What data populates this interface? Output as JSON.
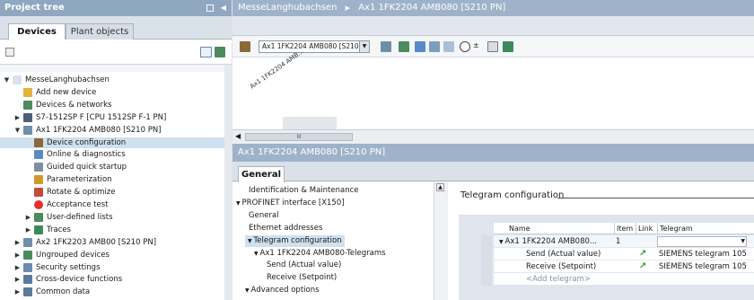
{
  "project_tree": {
    "title": "Project tree",
    "tabs": [
      "Devices",
      "Plant objects"
    ],
    "items": [
      {
        "label": "MesseLanghubachsen",
        "indent": 0,
        "arrow": "down",
        "icon": "project-icon",
        "color": "#d8e2ee"
      },
      {
        "label": "Add new device",
        "indent": 1,
        "arrow": "",
        "icon": "add-device-icon",
        "color": "#e3b23c"
      },
      {
        "label": "Devices & networks",
        "indent": 1,
        "arrow": "",
        "icon": "network-icon",
        "color": "#4c8a5f"
      },
      {
        "label": "S7-1512SP F [CPU 1512SP F-1 PN]",
        "indent": 1,
        "arrow": "right",
        "icon": "cpu-icon",
        "color": "#4a5f7a"
      },
      {
        "label": "Ax1 1FK2204 AMB080 [S210 PN]",
        "indent": 1,
        "arrow": "down",
        "icon": "drive-icon",
        "color": "#6f8fa8"
      },
      {
        "label": "Device configuration",
        "indent": 2,
        "arrow": "",
        "icon": "device-config-icon",
        "color": "#8a6a3a",
        "selected": true
      },
      {
        "label": "Online & diagnostics",
        "indent": 2,
        "arrow": "",
        "icon": "diagnostics-icon",
        "color": "#5a89c9"
      },
      {
        "label": "Guided quick startup",
        "indent": 2,
        "arrow": "",
        "icon": "startup-icon",
        "color": "#7f8f9f"
      },
      {
        "label": "Parameterization",
        "indent": 2,
        "arrow": "",
        "icon": "parameter-icon",
        "color": "#d09a2a"
      },
      {
        "label": "Rotate & optimize",
        "indent": 2,
        "arrow": "",
        "icon": "optimize-icon",
        "color": "#c44a3a"
      },
      {
        "label": "Acceptance test",
        "indent": 2,
        "arrow": "",
        "icon": "acceptance-icon",
        "color": "#e2302a"
      },
      {
        "label": "User-defined lists",
        "indent": 2,
        "arrow": "right",
        "icon": "list-icon",
        "color": "#4c8a5f"
      },
      {
        "label": "Traces",
        "indent": 2,
        "arrow": "right",
        "icon": "trace-icon",
        "color": "#3c8a5a"
      },
      {
        "label": "Ax2 1FK2203 AMB00 [S210 PN]",
        "indent": 1,
        "arrow": "right",
        "icon": "drive-icon",
        "color": "#6f8fa8"
      },
      {
        "label": "Ungrouped devices",
        "indent": 1,
        "arrow": "right",
        "icon": "folder-icon",
        "color": "#4c8a5f"
      },
      {
        "label": "Security settings",
        "indent": 1,
        "arrow": "right",
        "icon": "security-icon",
        "color": "#6a8ab0"
      },
      {
        "label": "Cross-device functions",
        "indent": 1,
        "arrow": "right",
        "icon": "cross-device-icon",
        "color": "#5a7aa0"
      },
      {
        "label": "Common data",
        "indent": 1,
        "arrow": "right",
        "icon": "common-data-icon",
        "color": "#5a7aa0"
      }
    ]
  },
  "editor": {
    "breadcrumb": [
      "MesseLanghubachsen",
      "Ax1 1FK2204 AMB080 [S210 PN]"
    ],
    "device_select": "Ax1 1FK2204 AMB080 [S210 P",
    "device_label": "Ax1 1FK2204 AMB...",
    "scroll_grip": "III"
  },
  "inspector": {
    "title": "Ax1 1FK2204 AMB080 [S210 PN]",
    "tab": "General",
    "nav": [
      {
        "label": "Identification & Maintenance",
        "indent": 1,
        "arrow": ""
      },
      {
        "label": "PROFINET interface [X150]",
        "indent": 0,
        "arrow": "down"
      },
      {
        "label": "General",
        "indent": 1,
        "arrow": ""
      },
      {
        "label": "Ethernet addresses",
        "indent": 1,
        "arrow": ""
      },
      {
        "label": "Telegram configuration",
        "indent": 1,
        "arrow": "down",
        "selected": true
      },
      {
        "label": "Ax1 1FK2204 AMB080-Telegrams",
        "indent": 2,
        "arrow": "down"
      },
      {
        "label": "Send (Actual value)",
        "indent": 3,
        "arrow": ""
      },
      {
        "label": "Receive (Setpoint)",
        "indent": 3,
        "arrow": ""
      },
      {
        "label": "Advanced options",
        "indent": 1,
        "arrow": "down"
      }
    ],
    "section_title": "Telegram configuration",
    "table": {
      "headers": [
        "Name",
        "Item",
        "Link",
        "Telegram"
      ],
      "rows": [
        {
          "name": "Ax1 1FK2204 AMB080...",
          "item": "1",
          "link": "",
          "telegram": "",
          "expanded": true,
          "selected": true
        },
        {
          "name": "Send (Actual value)",
          "item": "",
          "link": "link-arrow-icon",
          "telegram": "SIEMENS telegram 105"
        },
        {
          "name": "Receive (Setpoint)",
          "item": "",
          "link": "link-arrow-icon",
          "telegram": "SIEMENS telegram 105"
        },
        {
          "name": "<Add telegram>",
          "item": "",
          "link": "",
          "telegram": "",
          "placeholder": true
        }
      ]
    }
  },
  "colors": {
    "title_bar": "#8fa7c0",
    "selection": "#cfe0ee",
    "link_green": "#2a9a3a"
  }
}
